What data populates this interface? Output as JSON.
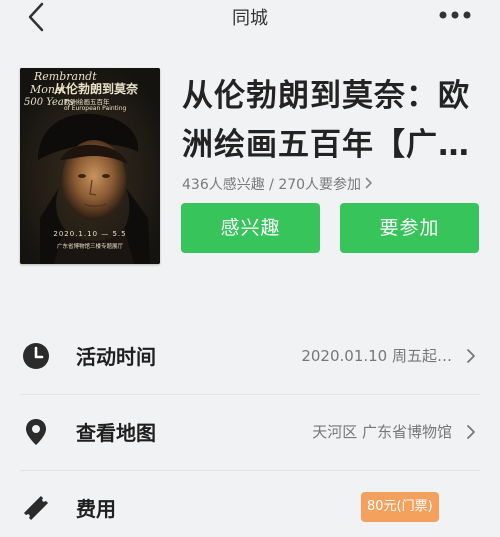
{
  "header": {
    "title": "同城"
  },
  "poster": {
    "line_rembrandt": "Rembrandt",
    "line_monet": "Monet",
    "line_years": "500 Years",
    "title_cn": "从伦勃朗到莫奈",
    "subtitle_cn": "欧洲绘画五百年",
    "subtitle_en": "of European Painting",
    "date": "2020.1.10 — 5.5",
    "venue": "广东省博物馆三楼专题展厅"
  },
  "event": {
    "title": "从伦勃朗到莫奈：欧洲绘画五百年【广…",
    "stats": "436人感兴趣 / 270人要参加"
  },
  "actions": {
    "interested_label": "感兴趣",
    "join_label": "要参加"
  },
  "info": {
    "time": {
      "label": "活动时间",
      "value": "2020.01.10 周五起…"
    },
    "map": {
      "label": "查看地图",
      "value": "天河区 广东省博物馆"
    },
    "fee": {
      "label": "费用",
      "badge": "80元(门票)"
    }
  },
  "colors": {
    "accent_green": "#36c45b",
    "fee_badge": "#f4a15e",
    "background": "#f1f2f4"
  },
  "icons": {
    "back": "chevron-left-icon",
    "more": "more-horizontal-icon",
    "time": "clock-icon",
    "map": "map-pin-icon",
    "fee": "ticket-icon"
  }
}
